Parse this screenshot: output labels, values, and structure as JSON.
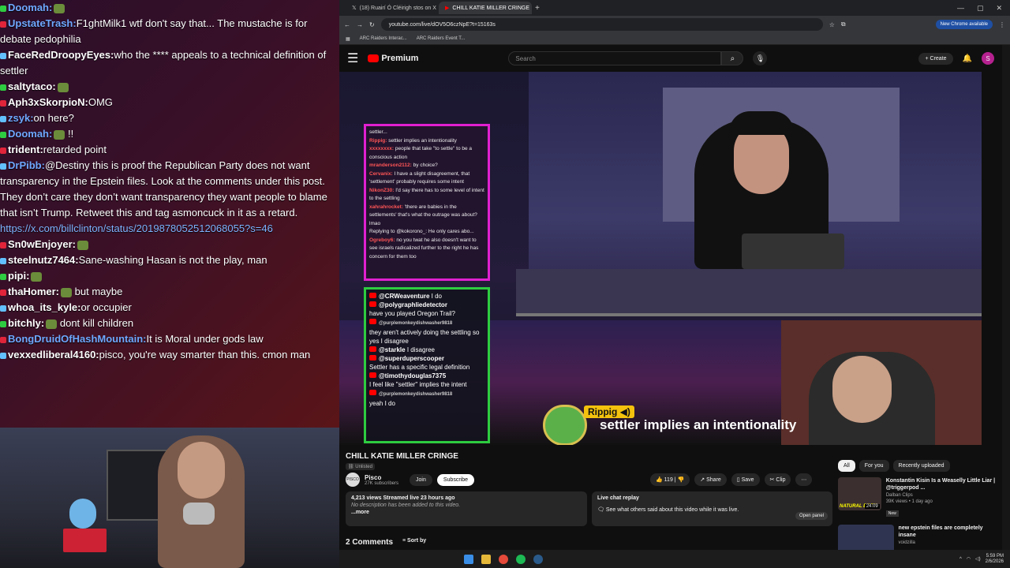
{
  "chat": [
    {
      "user": "Doomah:",
      "text": "",
      "color": "#6fa8ff",
      "emote": true
    },
    {
      "user": "UpstateTrash:",
      "text": "F1ghtMilk1 wtf don't say that... The mustache is for debate pedophilia",
      "color": "#6fa8ff"
    },
    {
      "user": "FaceRedDroopyEyes:",
      "text": "who the **** appeals to a technical definition of settler",
      "color": "#fff"
    },
    {
      "user": "saltytaco:",
      "text": "",
      "color": "#fff",
      "emote": true
    },
    {
      "user": "Aph3xSkorpioN:",
      "text": "OMG",
      "color": "#fff"
    },
    {
      "user": "zsyk:",
      "text": "on here?",
      "color": "#6fa8ff"
    },
    {
      "user": "Doomah:",
      "text": "!!",
      "color": "#6fa8ff",
      "emote": true
    },
    {
      "user": "trident:",
      "text": "retarded point",
      "color": "#fff"
    },
    {
      "user": "DrPibb:",
      "text": "@Destiny this is proof the Republican Party does not want transparency in the Epstein files. Look at the comments under this post. They don’t care they don’t want transparency they want people to blame that isn’t Trump. Retweet this and tag asmoncuck in it as a retard.",
      "color": "#6fa8ff"
    },
    {
      "user": "",
      "text": "https://x.com/billclinton/status/2019878052512068055?s=46",
      "color": "#7fb3ff",
      "link": true
    },
    {
      "user": "Sn0wEnjoyer:",
      "text": "",
      "color": "#fff",
      "emote": true
    },
    {
      "user": "steelnutz7464:",
      "text": "Sane-washing Hasan is not the play, man",
      "color": "#fff"
    },
    {
      "user": "pipi:",
      "text": "",
      "color": "#fff",
      "emote": true
    },
    {
      "user": "thaHomer:",
      "text": "but maybe",
      "color": "#fff",
      "emote": true
    },
    {
      "user": "whoa_its_kyle:",
      "text": "or occupier",
      "color": "#fff"
    },
    {
      "user": "bitchly:",
      "text": "dont kill children",
      "color": "#fff",
      "emote": true
    },
    {
      "user": "BongDruidOfHashMountain:",
      "text": "It is Moral under gods law",
      "color": "#6fa8ff"
    },
    {
      "user": "vexxedliberal4160:",
      "text": "pisco, you're way smarter than this. cmon man",
      "color": "#fff"
    }
  ],
  "browser": {
    "tab1": "(18) Ruairí Ó Cléirigh stos on X",
    "tab2": "CHILL KATIE MILLER CRINGE",
    "url": "youtube.com/live/dOV5O6czNpE?t=15163s",
    "bookmark1": "ARC Raiders Interac...",
    "bookmark2": "ARC Raiders Event T...",
    "new_chrome": "New Chrome available"
  },
  "yt": {
    "logo": "Premium",
    "search_placeholder": "Search",
    "create": "Create",
    "avatar": "S",
    "title": "CHILL KATIE MILLER CRINGE",
    "unlisted": "Unlisted",
    "channel": "Pisco",
    "channel_avatar": "PISCO",
    "subs": "27K subscribers",
    "join": "Join",
    "subscribe": "Subscribe",
    "likes": "119",
    "share": "Share",
    "save": "Save",
    "clip": "Clip",
    "views": "4,213 views  Streamed live 23 hours ago",
    "desc": "No description has been added to this video.",
    "more": "...more",
    "replay_title": "Live chat replay",
    "replay_text": "See what others said about this video while it was live.",
    "open_panel": "Open panel",
    "comments": "2 Comments",
    "sort": "Sort by",
    "chips": [
      "All",
      "For you",
      "Recently uploaded"
    ],
    "rec": [
      {
        "title": "Konstantin Kisin Is a Weaselly Little Liar | @triggerpod ...",
        "channel": "Dalban Clips",
        "meta": "39K views • 1 day ago",
        "badge": "New",
        "thumb_label": "NATURAL BORN",
        "duration": "24:09"
      },
      {
        "title": "new epstein files are completely insane",
        "channel": "voidzilla",
        "meta": "",
        "badge": "",
        "thumb_label": "",
        "duration": ""
      }
    ]
  },
  "video": {
    "pink_chat": [
      {
        "u": "",
        "t": "settler..."
      },
      {
        "u": "Rippig:",
        "t": "settler implies an intentionality"
      },
      {
        "u": "xxxxxxxx:",
        "t": "people that take \"to settle\" to be a conscious action"
      },
      {
        "u": "mranderson2112:",
        "t": "by choice?"
      },
      {
        "u": "Cervanix:",
        "t": "I have a slight disagreement, that 'settlement' probably requires some intent"
      },
      {
        "u": "NikonZ30:",
        "t": "I'd say there has to some level of intent to the settling"
      },
      {
        "u": "xahrahrocket:",
        "t": "'there are babies in the settlements' that's what the outrage was about? lmao"
      },
      {
        "u": "",
        "t": "Replying to @kokorono_: He only cares abo..."
      },
      {
        "u": "Ogreboy6:",
        "t": "no you twat he also doesn't want to see israels radicalized further to the right he has concern for them too"
      }
    ],
    "green_chat": [
      {
        "u": "@CRWeaventure",
        "t": "I do"
      },
      {
        "u": "@polygraphliedetector",
        "t": ""
      },
      {
        "u": "",
        "t": "have you played Oregon Trail?"
      },
      {
        "u": "@purplemonkeydishwasher9818",
        "t": "",
        "small": true
      },
      {
        "u": "",
        "t": "they aren't actively doing the settling so yes I disagree"
      },
      {
        "u": "@starkle",
        "t": "I disagree"
      },
      {
        "u": "@superduperscooper",
        "t": ""
      },
      {
        "u": "",
        "t": "Settler has a specific legal definition"
      },
      {
        "u": "@timothydouglas7375",
        "t": ""
      },
      {
        "u": "",
        "t": "I feel like \"settler\" implies the intent"
      },
      {
        "u": "@purplemonkeydishwasher9818",
        "t": "",
        "small": true
      },
      {
        "u": "",
        "t": "yeah I do"
      }
    ],
    "caption_user": "Rippig",
    "caption_text": "settler implies an intentionality"
  },
  "taskbar": {
    "time": "5:59 PM",
    "date": "2/6/2026"
  }
}
